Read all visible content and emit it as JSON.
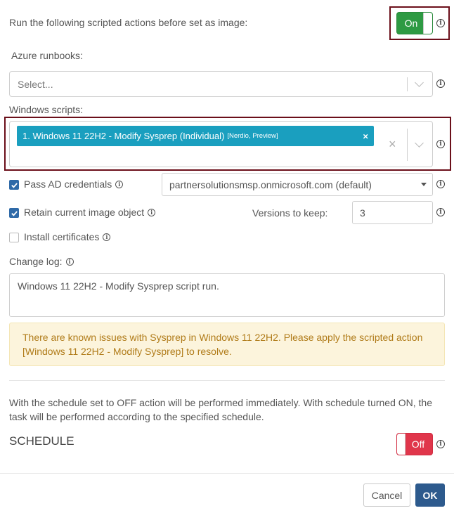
{
  "run_scripts": {
    "label": "Run the following scripted actions before set as image:",
    "toggle": "On"
  },
  "azure": {
    "label": "Azure runbooks:",
    "placeholder": "Select..."
  },
  "windows": {
    "label": "Windows scripts:",
    "chip_main": "1. Windows 11 22H2 - Modify Sysprep (Individual)",
    "chip_tags": "[Nerdio, Preview]",
    "chip_remove": "×",
    "clear": "×"
  },
  "pass_ad": {
    "label": "Pass AD credentials",
    "checked": true,
    "domain": "partnersolutionsmsp.onmicrosoft.com (default)"
  },
  "retain": {
    "label": "Retain current image object",
    "checked": true,
    "versions_label": "Versions to keep:",
    "versions_value": "3"
  },
  "certs": {
    "label": "Install certificates",
    "checked": false
  },
  "changelog": {
    "label": "Change log:",
    "value": "Windows 11 22H2 - Modify Sysprep script run."
  },
  "alert": {
    "text": "There are known issues with Sysprep in Windows 11 22H2. Please apply the scripted action [Windows 11 22H2 - Modify Sysprep] to resolve."
  },
  "schedule": {
    "note": "With the schedule set to OFF action will be performed immediately. With schedule turned ON, the task will be performed according to the specified schedule.",
    "title": "SCHEDULE",
    "toggle": "Off"
  },
  "footer": {
    "cancel": "Cancel",
    "ok": "OK"
  },
  "colors": {
    "toggle_on": "#2e9a43",
    "toggle_off": "#e0364b",
    "chip": "#1a9fbf",
    "ok_button": "#2d5a8d",
    "highlight_border": "#6b0f1a"
  }
}
